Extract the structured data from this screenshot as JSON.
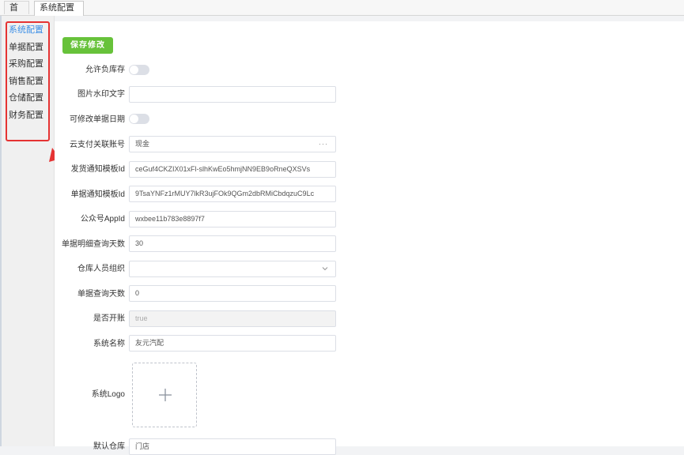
{
  "tabs": [
    {
      "label": "首页"
    },
    {
      "label": "系统配置",
      "close": "×"
    }
  ],
  "sidebar": {
    "items": [
      {
        "label": "系统配置"
      },
      {
        "label": "单据配置"
      },
      {
        "label": "采购配置"
      },
      {
        "label": "销售配置"
      },
      {
        "label": "仓储配置"
      },
      {
        "label": "财务配置"
      }
    ],
    "active_index": 0
  },
  "toolbar": {
    "save_label": "保存修改"
  },
  "form": {
    "allow_negative_stock": {
      "label": "允许负库存",
      "on": false
    },
    "watermark_text": {
      "label": "图片水印文字",
      "value": ""
    },
    "editable_doc_date": {
      "label": "可修改单据日期",
      "on": false
    },
    "cloud_pay_account": {
      "label": "云支付关联账号",
      "value": "现金",
      "more": "···"
    },
    "ship_template_id": {
      "label": "发货通知模板Id",
      "value": "ceGuf4CKZIX01xFl-slhKwEo5hmjNN9EB9oRneQXSVs"
    },
    "doc_template_id": {
      "label": "单据通知模板Id",
      "value": "9TsaYNFz1rMUY7lkR3ujFOk9QGm2dbRMiCbdqzuC9Lc"
    },
    "official_appid": {
      "label": "公众号AppId",
      "value": "wxbee11b783e8897f7"
    },
    "detail_query_days": {
      "label": "单据明细查询天数",
      "value": "30"
    },
    "warehouse_org": {
      "label": "仓库人员组织",
      "value": ""
    },
    "doc_query_days": {
      "label": "单据查询天数",
      "value": "0"
    },
    "is_open_account": {
      "label": "是否开账",
      "value": "true"
    },
    "system_name": {
      "label": "系统名称",
      "value": "友元汽配"
    },
    "system_logo": {
      "label": "系统Logo"
    },
    "partial_field": {
      "label": "默认仓库",
      "value": "门店"
    }
  },
  "colors": {
    "accent": "#3a8ee6",
    "save_button": "#67c23a",
    "annotation": "#e53333"
  }
}
